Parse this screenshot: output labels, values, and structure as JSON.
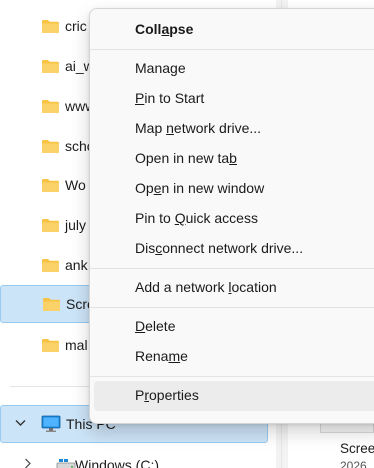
{
  "nav": {
    "folders": [
      {
        "label": "cric"
      },
      {
        "label": "ai_w"
      },
      {
        "label": "www"
      },
      {
        "label": "scho"
      },
      {
        "label": "Wo"
      },
      {
        "label": "july"
      },
      {
        "label": "ank"
      },
      {
        "label": "Scre",
        "selected": true
      },
      {
        "label": "mal"
      }
    ],
    "this_pc": {
      "label": "This PC"
    },
    "drive": {
      "label": "Windows (C:)"
    }
  },
  "content": {
    "file_label": "Scree",
    "file_sub": "2026"
  },
  "context_menu": {
    "items": [
      {
        "id": "collapse",
        "pre": "Coll",
        "key": "a",
        "post": "pse",
        "bold": true
      },
      {
        "id": "manage",
        "pre": "Mana",
        "key": "g",
        "post": "e"
      },
      {
        "id": "pin-to-start",
        "pre": "",
        "key": "P",
        "post": "in to Start"
      },
      {
        "id": "map-network-drive",
        "pre": "Map ",
        "key": "n",
        "post": "etwork drive..."
      },
      {
        "id": "open-in-new-tab",
        "pre": "Open in new ta",
        "key": "b",
        "post": ""
      },
      {
        "id": "open-in-new-window",
        "pre": "Op",
        "key": "e",
        "post": "n in new window"
      },
      {
        "id": "pin-to-quick-access",
        "pre": "Pin to ",
        "key": "Q",
        "post": "uick access"
      },
      {
        "id": "disconnect-network-drive",
        "pre": "Dis",
        "key": "c",
        "post": "onnect network drive..."
      },
      {
        "id": "add-network-location",
        "pre": "Add a network ",
        "key": "l",
        "post": "ocation"
      },
      {
        "id": "delete",
        "pre": "",
        "key": "D",
        "post": "elete"
      },
      {
        "id": "rename",
        "pre": "Rena",
        "key": "m",
        "post": "e"
      },
      {
        "id": "properties",
        "pre": "P",
        "key": "r",
        "post": "operties",
        "hover": true
      }
    ]
  },
  "colors": {
    "selection_bg": "#cce4f7",
    "selection_border": "#99c9ef",
    "folder_yellow": "#f8c244",
    "folder_dark": "#e0a31f",
    "menu_bg": "#f9f9f9",
    "pc_monitor": "#1e88d6"
  },
  "icons": {
    "folder": "folder-icon",
    "chevron_down": "chevron-down-icon",
    "chevron_right": "chevron-right-icon",
    "pc": "this-pc-icon",
    "drive": "drive-icon"
  }
}
